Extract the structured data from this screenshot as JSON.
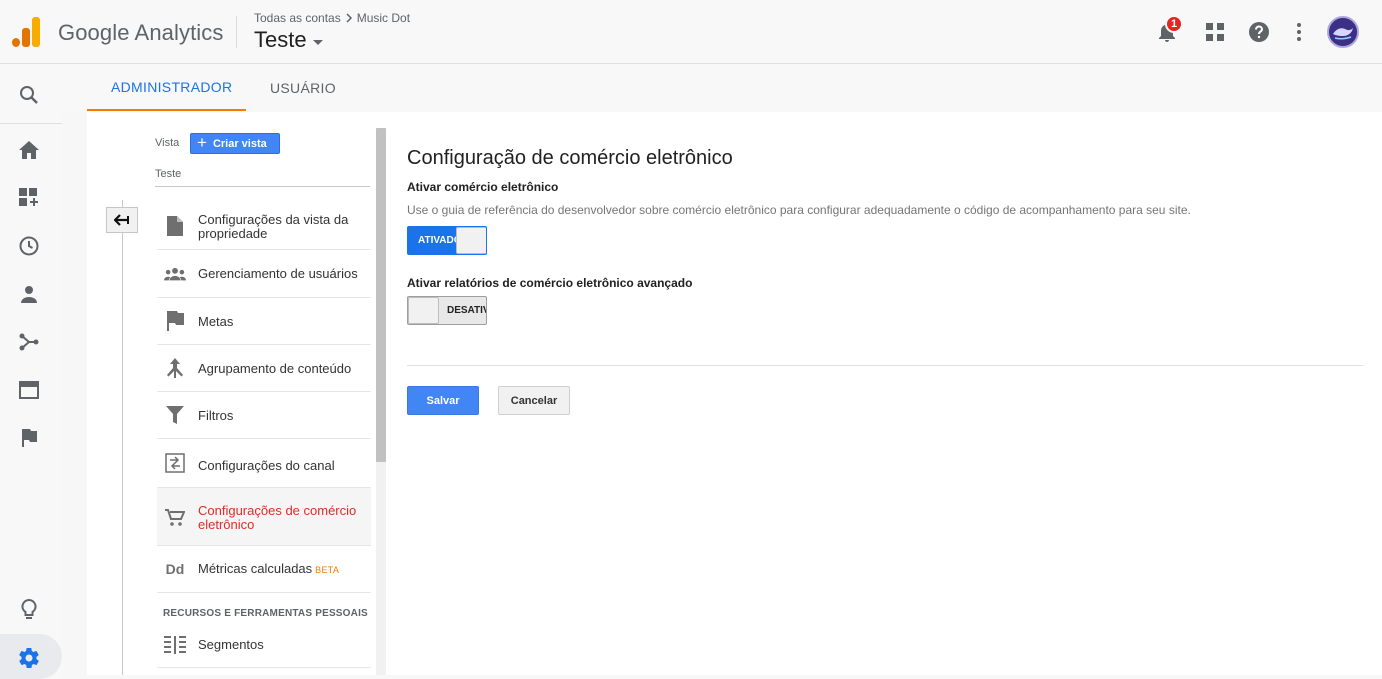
{
  "header": {
    "app_name": "Google Analytics",
    "breadcrumb": [
      "Todas as contas",
      "Music Dot"
    ],
    "view_title": "Teste",
    "notification_count": "1",
    "icons": [
      "notifications-icon",
      "apps-grid-icon",
      "help-icon",
      "more-vert-icon",
      "avatar"
    ]
  },
  "rail": {
    "icons": [
      "search-icon",
      "home-icon",
      "customization-icon",
      "realtime-clock-icon",
      "audience-person-icon",
      "acquisition-icon",
      "behavior-icon",
      "conversions-flag-icon",
      "lightbulb-icon",
      "settings-gear-icon"
    ]
  },
  "tabs": [
    {
      "label": "ADMINISTRADOR",
      "active": true
    },
    {
      "label": "USUÁRIO",
      "active": false
    }
  ],
  "view_column": {
    "vista_label": "Vista",
    "create_view_label": "Criar vista",
    "view_name": "Teste",
    "items": [
      {
        "label": "Configurações da vista da propriedade",
        "icon": "document-icon"
      },
      {
        "label": "Gerenciamento de usuários",
        "icon": "users-group-icon"
      },
      {
        "label": "Metas",
        "icon": "flag-icon"
      },
      {
        "label": "Agrupamento de conteúdo",
        "icon": "content-grouping-icon"
      },
      {
        "label": "Filtros",
        "icon": "filter-icon"
      },
      {
        "label": "Configurações do canal",
        "icon": "channel-settings-icon"
      },
      {
        "label": "Configurações de comércio eletrônico",
        "icon": "cart-icon",
        "selected": true
      },
      {
        "label": "Métricas calculadas",
        "badge": "BETA",
        "icon": "dd-icon"
      }
    ],
    "section_header": "RECURSOS E FERRAMENTAS PESSOAIS",
    "personal_items": [
      {
        "label": "Segmentos",
        "icon": "segments-icon"
      }
    ]
  },
  "main": {
    "title": "Configuração de comércio eletrônico",
    "ecommerce_label": "Ativar comércio eletrônico",
    "ecommerce_desc": "Use o guia de referência do desenvolvedor sobre comércio eletrônico para configurar adequadamente o código de acompanhamento para seu site.",
    "ecommerce_toggle": {
      "state": "on",
      "label": "ATIVADO"
    },
    "enhanced_label": "Ativar relatórios de comércio eletrônico avançado",
    "enhanced_toggle": {
      "state": "off",
      "label": "DESATIVADO"
    },
    "save_label": "Salvar",
    "cancel_label": "Cancelar"
  },
  "colors": {
    "accent_blue": "#1a73e8",
    "button_blue": "#4285f4",
    "tab_underline": "#f57c00",
    "selected_red": "#d93025",
    "logo_orange": "#f9ab00",
    "logo_dark_orange": "#e37400"
  }
}
